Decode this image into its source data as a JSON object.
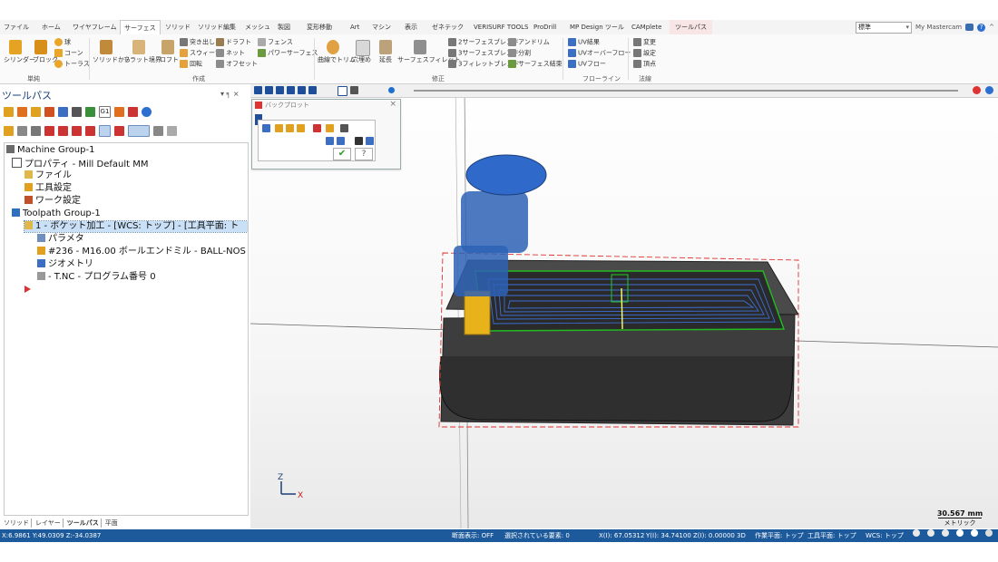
{
  "menu": {
    "items": [
      "ファイル",
      "ホーム",
      "ワイヤフレーム",
      "サーフェス",
      "ソリッド",
      "ソリッド編集",
      "メッシュ",
      "製図",
      "変形移動",
      "Art",
      "マシン",
      "表示",
      "ゼネテック",
      "VERISURF TOOLS",
      "ProDrill",
      "MP Design ツール",
      "CAMplete",
      "ツールパス"
    ],
    "active_index": 3,
    "workspace": "標準",
    "account": "My Mastercam",
    "help_icon": "question-icon"
  },
  "ribbon": {
    "basic": {
      "label": "単純",
      "items": [
        "シリンダー",
        "ブロック",
        "球",
        "コーン",
        "トーラス"
      ]
    },
    "create": {
      "label": "作成",
      "items": [
        "ソリッドから",
        "フラット境界",
        "ロフト",
        "突き出し",
        "スウィープ",
        "回転",
        "ドラフト",
        "ネット",
        "オフセット",
        "フェンス",
        "パワーサーフェス"
      ]
    },
    "modify": {
      "label": "修正",
      "items": [
        "曲線でトリム",
        "穴埋め",
        "延長",
        "サーフェスフィレット",
        "2サーフェスブレンド",
        "3サーフェスブレンド",
        "3フィレットブレンド",
        "アンドリム",
        "分割",
        "サーフェス結束"
      ]
    },
    "flowline": {
      "label": "フローライン",
      "items": [
        "UV結果",
        "UVオーバーフロー",
        "UVフロー"
      ]
    },
    "normal": {
      "label": "法線",
      "items": [
        "変更",
        "設定",
        "頂点"
      ]
    }
  },
  "panel": {
    "title": "ツールパス",
    "pin": "▾ ╕ ×",
    "tabs": [
      "ソリッド",
      "レイヤー",
      "ツールパス",
      "平面"
    ]
  },
  "tree": [
    {
      "label": "Machine Group-1",
      "indent": 0
    },
    {
      "label": "プロパティ - Mill Default MM",
      "indent": 1
    },
    {
      "label": "ファイル",
      "indent": 2
    },
    {
      "label": "工具設定",
      "indent": 2
    },
    {
      "label": "ワーク設定",
      "indent": 2
    },
    {
      "label": "Toolpath Group-1",
      "indent": 1
    },
    {
      "label": "1 - ポケット加工 - [WCS: トップ] - [工具平面: ト",
      "indent": 2,
      "selected": true
    },
    {
      "label": "パラメタ",
      "indent": 3
    },
    {
      "label": "#236 - M16.00 ボールエンドミル - BALL-NOS",
      "indent": 3
    },
    {
      "label": "ジオメトリ",
      "indent": 3
    },
    {
      "label": "- T.NC - プログラム番号 0",
      "indent": 3
    },
    {
      "label": "",
      "indent": 2
    }
  ],
  "backplot": {
    "title": "バックプロット",
    "close": "×",
    "ok_icon": "check-icon",
    "help_icon": "question-icon"
  },
  "viewport": {
    "axis_z": "Z",
    "axis_x": "X",
    "scale_value": "30.567 mm",
    "scale_unit": "メトリック",
    "colors": {
      "part": "#3c3c3c",
      "tool": "#2d62b5",
      "holder": "#e8b21b",
      "path": "#3d6fd6",
      "stock": "#e03030",
      "boundary": "#22bb22"
    }
  },
  "status": {
    "coords_left": "X:6.9861  Y:49.0309  Z:-34.0387",
    "section": "断面表示: OFF",
    "selected": "選択されている要素: 0",
    "x": "X(I): 67.05312",
    "y": "Y(I): 34.74100",
    "z": "Z(I): 0.00000",
    "mode": "3D",
    "cplane": "作業平面: トップ",
    "tplane": "工具平面: トップ",
    "wcs": "WCS: トップ"
  }
}
